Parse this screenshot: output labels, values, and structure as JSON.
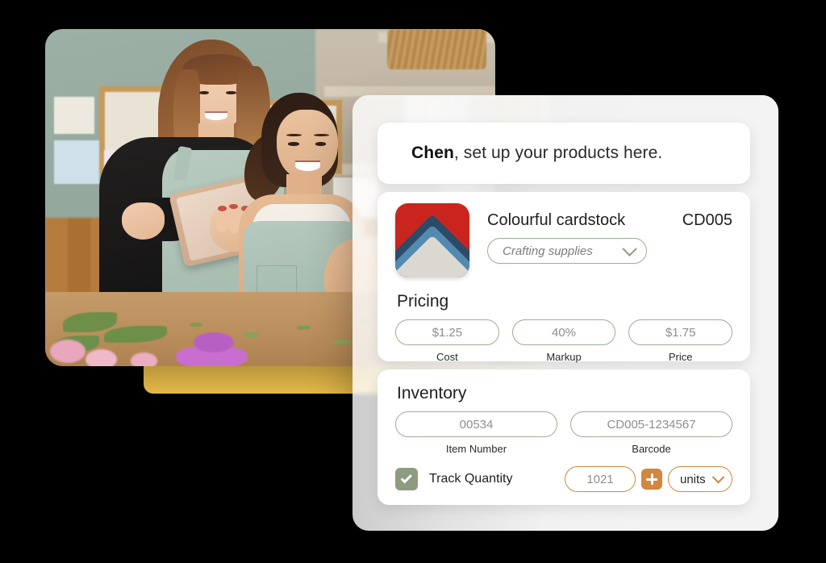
{
  "greeting": {
    "name": "Chen",
    "rest": ", set up your products here."
  },
  "product": {
    "name": "Colourful cardstock",
    "sku": "CD005",
    "category": "Crafting supplies",
    "thumbnail_colors": {
      "background": "#C9251E",
      "chevron_navy": "#2C4B68",
      "chevron_blue": "#538BB0",
      "chevron_gray": "#DBD8D1"
    }
  },
  "pricing": {
    "title": "Pricing",
    "fields": [
      {
        "value": "$1.25",
        "caption": "Cost"
      },
      {
        "value": "40%",
        "caption": "Markup"
      },
      {
        "value": "$1.75",
        "caption": "Price"
      }
    ]
  },
  "inventory": {
    "title": "Inventory",
    "fields": [
      {
        "value": "00534",
        "caption": "Item Number"
      },
      {
        "value": "CD005-1234567",
        "caption": "Barcode"
      }
    ],
    "track_quantity": {
      "label": "Track Quantity",
      "checked": true,
      "quantity": "1021",
      "unit": "units",
      "add_icon": "plus-icon"
    }
  },
  "theme": {
    "accent_yellow": "#F2C44D",
    "field_border_green": "#9AAE92",
    "checkbox_green": "#8D9C80",
    "accent_orange": "#D0873F"
  },
  "photo": {
    "alt": "Two women in aprons looking at a tablet in a craft shop"
  }
}
